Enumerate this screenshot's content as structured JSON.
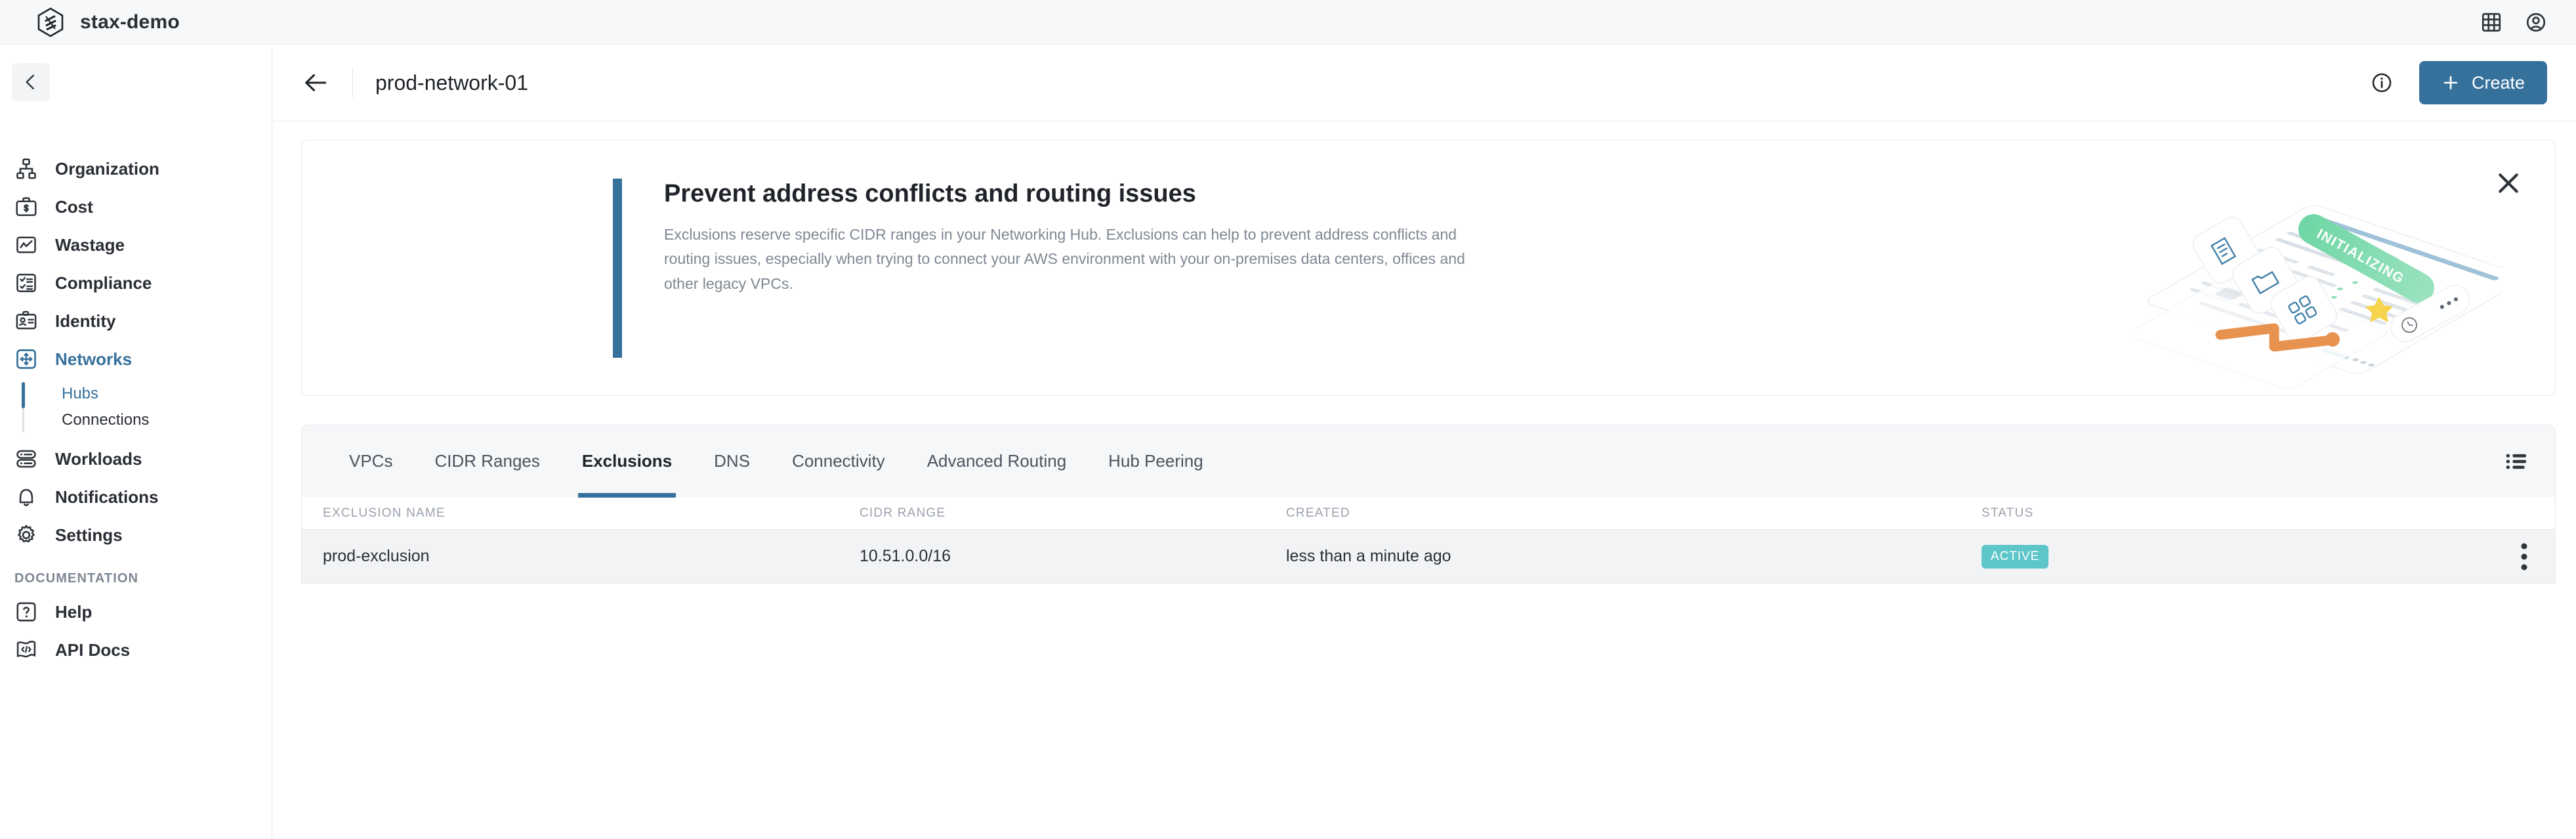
{
  "appbar": {
    "brand_name": "stax-demo",
    "logo_icon": "stax-hex-logo-icon",
    "apps_icon": "grid-apps-icon",
    "account_icon": "user-account-icon"
  },
  "sidebar": {
    "collapse_icon": "chevron-left-icon",
    "items": [
      {
        "label": "Organization",
        "icon": "org-chart-icon",
        "active": false
      },
      {
        "label": "Cost",
        "icon": "briefcase-dollar-icon",
        "active": false
      },
      {
        "label": "Wastage",
        "icon": "chart-line-box-icon",
        "active": false
      },
      {
        "label": "Compliance",
        "icon": "checklist-icon",
        "active": false
      },
      {
        "label": "Identity",
        "icon": "id-card-icon",
        "active": false
      },
      {
        "label": "Networks",
        "icon": "network-arrows-icon",
        "active": true
      }
    ],
    "subitems": [
      {
        "label": "Hubs",
        "active": true
      },
      {
        "label": "Connections",
        "active": false
      }
    ],
    "items_after": [
      {
        "label": "Workloads",
        "icon": "server-stack-icon",
        "active": false
      },
      {
        "label": "Notifications",
        "icon": "bell-icon",
        "active": false
      },
      {
        "label": "Settings",
        "icon": "gear-icon",
        "active": false
      }
    ],
    "section_label": "DOCUMENTATION",
    "doc_items": [
      {
        "label": "Help",
        "icon": "question-box-icon"
      },
      {
        "label": "API Docs",
        "icon": "code-flag-icon"
      }
    ]
  },
  "header": {
    "back_icon": "arrow-left-icon",
    "title": "prod-network-01",
    "info_icon": "info-circle-icon",
    "create_label": "Create",
    "plus_icon": "plus-icon"
  },
  "banner": {
    "title": "Prevent address conflicts and routing issues",
    "body": "Exclusions reserve specific CIDR ranges in your Networking Hub. Exclusions can help to prevent address conflicts and routing issues, especially when trying to connect your AWS environment with your on-premises data centers, offices and other legacy VPCs.",
    "close_icon": "close-x-icon",
    "illustration_badge": "INITIALIZING",
    "accent_color": "#36719c"
  },
  "tabs": {
    "items": [
      {
        "label": "VPCs",
        "active": false
      },
      {
        "label": "CIDR Ranges",
        "active": false
      },
      {
        "label": "Exclusions",
        "active": true
      },
      {
        "label": "DNS",
        "active": false
      },
      {
        "label": "Connectivity",
        "active": false
      },
      {
        "label": "Advanced Routing",
        "active": false
      },
      {
        "label": "Hub Peering",
        "active": false
      }
    ],
    "list_view_icon": "list-view-icon"
  },
  "table": {
    "columns": [
      "EXCLUSION NAME",
      "CIDR RANGE",
      "CREATED",
      "STATUS"
    ],
    "rows": [
      {
        "name": "prod-exclusion",
        "cidr": "10.51.0.0/16",
        "created": "less than a minute ago",
        "status": "ACTIVE",
        "status_color": "#5cc6c9",
        "menu_icon": "kebab-menu-icon"
      }
    ]
  }
}
